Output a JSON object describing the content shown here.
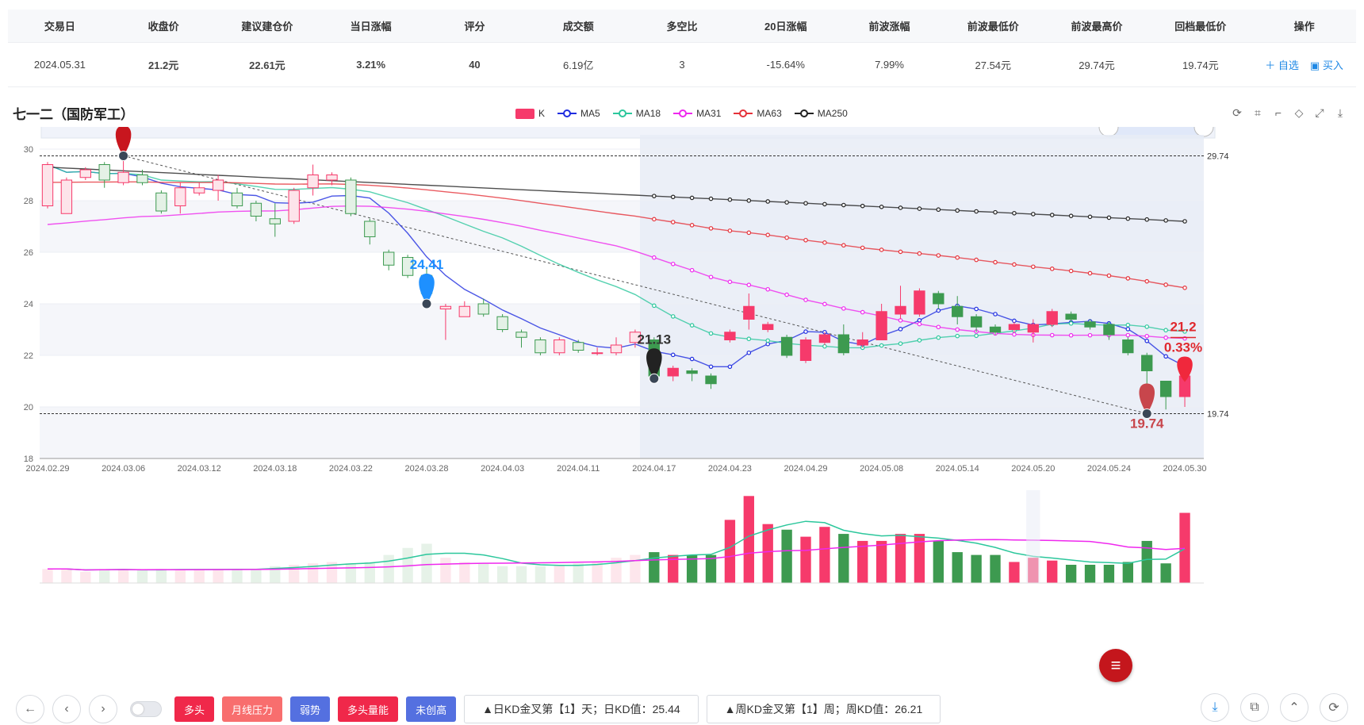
{
  "summary": {
    "headers": [
      "交易日",
      "收盘价",
      "建议建仓价",
      "当日涨幅",
      "评分",
      "成交额",
      "多空比",
      "20日涨幅",
      "前波涨幅",
      "前波最低价",
      "前波最高价",
      "回档最低价",
      "操作"
    ],
    "values": {
      "date": "2024.05.31",
      "close": "21.2元",
      "suggest": "22.61元",
      "day_change": "3.21%",
      "score": "40",
      "amount": "6.19亿",
      "ratio": "3",
      "change20": "-15.64%",
      "wave_change": "7.99%",
      "wave_low": "27.54元",
      "wave_high": "29.74元",
      "pull_low": "19.74元"
    },
    "ops": [
      "＋ 自选",
      "买入"
    ]
  },
  "chart": {
    "stock_name": "七一二（国防军工）",
    "legend": [
      "K",
      "MA5",
      "MA18",
      "MA31",
      "MA63",
      "MA250"
    ],
    "colors": {
      "up": "#f63a6b",
      "down": "#3d9a50",
      "ma5": "#1f2de0",
      "ma18": "#2cc79c",
      "ma31": "#ef28ee",
      "ma63": "#e5323a",
      "ma250": "#222222"
    },
    "y_ticks": [
      "30",
      "28",
      "26",
      "24",
      "22",
      "20",
      "18"
    ],
    "x_ticks": [
      "2024.02.29",
      "2024.03.06",
      "2024.03.12",
      "2024.03.18",
      "2024.03.22",
      "2024.03.28",
      "2024.04.03",
      "2024.04.11",
      "2024.04.17",
      "2024.04.23",
      "2024.04.29",
      "2024.05.08",
      "2024.05.14",
      "2024.05.20",
      "2024.05.24",
      "2024.05.30"
    ],
    "ref_high": "29.74",
    "ref_low": "19.74",
    "marker_high": "29.74",
    "marker_mid1": "24.41",
    "marker_mid2": "21.13",
    "marker_low": "19.74",
    "last_price": "21.2",
    "last_change": "0.33%"
  },
  "chart_data": {
    "type": "candlestick",
    "ylim": [
      18,
      30
    ],
    "dates": [
      "2024.02.29",
      "2024.03.01",
      "2024.03.04",
      "2024.03.05",
      "2024.03.06",
      "2024.03.07",
      "2024.03.08",
      "2024.03.11",
      "2024.03.12",
      "2024.03.13",
      "2024.03.14",
      "2024.03.15",
      "2024.03.18",
      "2024.03.19",
      "2024.03.20",
      "2024.03.21",
      "2024.03.22",
      "2024.03.25",
      "2024.03.26",
      "2024.03.27",
      "2024.03.28",
      "2024.03.29",
      "2024.04.01",
      "2024.04.02",
      "2024.04.03",
      "2024.04.08",
      "2024.04.09",
      "2024.04.10",
      "2024.04.11",
      "2024.04.12",
      "2024.04.15",
      "2024.04.16",
      "2024.04.17",
      "2024.04.18",
      "2024.04.19",
      "2024.04.22",
      "2024.04.23",
      "2024.04.24",
      "2024.04.25",
      "2024.04.26",
      "2024.04.29",
      "2024.04.30",
      "2024.05.06",
      "2024.05.07",
      "2024.05.08",
      "2024.05.09",
      "2024.05.10",
      "2024.05.13",
      "2024.05.14",
      "2024.05.15",
      "2024.05.16",
      "2024.05.17",
      "2024.05.20",
      "2024.05.21",
      "2024.05.22",
      "2024.05.23",
      "2024.05.24",
      "2024.05.27",
      "2024.05.28",
      "2024.05.29",
      "2024.05.30"
    ],
    "ohlc": [
      [
        27.8,
        29.4,
        27.7,
        29.5
      ],
      [
        27.5,
        28.8,
        27.5,
        28.9
      ],
      [
        28.9,
        29.2,
        28.8,
        29.3
      ],
      [
        29.4,
        28.8,
        28.5,
        29.5
      ],
      [
        28.7,
        29.1,
        28.6,
        29.7
      ],
      [
        29.0,
        28.7,
        28.6,
        29.2
      ],
      [
        28.3,
        27.6,
        27.5,
        28.4
      ],
      [
        27.8,
        28.5,
        27.5,
        28.7
      ],
      [
        28.3,
        28.5,
        28.2,
        28.7
      ],
      [
        28.4,
        28.8,
        28.0,
        29.0
      ],
      [
        28.3,
        27.8,
        27.7,
        28.5
      ],
      [
        27.9,
        27.4,
        27.2,
        28.0
      ],
      [
        27.3,
        27.1,
        26.6,
        27.9
      ],
      [
        27.2,
        28.4,
        27.1,
        28.5
      ],
      [
        28.5,
        29.0,
        28.2,
        29.4
      ],
      [
        28.8,
        29.0,
        28.6,
        29.1
      ],
      [
        28.8,
        27.5,
        27.4,
        28.9
      ],
      [
        27.2,
        26.6,
        26.3,
        27.3
      ],
      [
        26.0,
        25.5,
        25.3,
        26.1
      ],
      [
        25.8,
        25.1,
        25.0,
        25.9
      ],
      [
        25.1,
        24.4,
        24.0,
        25.4
      ],
      [
        23.8,
        23.9,
        22.6,
        24.0
      ],
      [
        23.5,
        23.9,
        23.5,
        24.1
      ],
      [
        24.0,
        23.6,
        23.5,
        24.2
      ],
      [
        23.5,
        23.0,
        22.9,
        23.6
      ],
      [
        22.9,
        22.7,
        22.3,
        23.0
      ],
      [
        22.6,
        22.1,
        22.0,
        22.7
      ],
      [
        22.1,
        22.6,
        22.0,
        22.7
      ],
      [
        22.5,
        22.2,
        22.1,
        22.6
      ],
      [
        22.1,
        22.1,
        22.0,
        22.3
      ],
      [
        22.1,
        22.4,
        22.0,
        22.7
      ],
      [
        22.5,
        22.9,
        22.3,
        23.0
      ],
      [
        22.6,
        21.2,
        21.1,
        22.7
      ],
      [
        21.2,
        21.5,
        21.0,
        21.6
      ],
      [
        21.4,
        21.3,
        21.0,
        21.5
      ],
      [
        21.2,
        20.9,
        20.7,
        21.3
      ],
      [
        22.6,
        22.9,
        22.5,
        23.0
      ],
      [
        23.4,
        23.9,
        23.0,
        24.4
      ],
      [
        23.0,
        23.2,
        22.9,
        23.3
      ],
      [
        22.7,
        22.0,
        21.9,
        22.8
      ],
      [
        21.8,
        22.6,
        21.7,
        22.7
      ],
      [
        22.5,
        22.8,
        22.4,
        22.9
      ],
      [
        22.8,
        22.1,
        22.0,
        23.2
      ],
      [
        22.4,
        22.6,
        22.3,
        22.9
      ],
      [
        22.6,
        23.7,
        22.6,
        24.0
      ],
      [
        23.6,
        23.9,
        23.4,
        24.7
      ],
      [
        23.6,
        24.5,
        23.5,
        24.6
      ],
      [
        24.4,
        24.0,
        23.8,
        24.5
      ],
      [
        23.9,
        23.5,
        23.2,
        24.3
      ],
      [
        23.5,
        23.1,
        22.9,
        23.6
      ],
      [
        23.1,
        22.9,
        22.8,
        23.2
      ],
      [
        23.0,
        23.2,
        22.9,
        23.3
      ],
      [
        22.9,
        23.2,
        22.5,
        23.4
      ],
      [
        23.2,
        23.7,
        23.1,
        23.8
      ],
      [
        23.6,
        23.4,
        23.3,
        23.7
      ],
      [
        23.3,
        23.1,
        23.0,
        23.4
      ],
      [
        23.2,
        22.8,
        22.6,
        23.3
      ],
      [
        22.6,
        22.1,
        22.0,
        22.7
      ],
      [
        22.0,
        21.4,
        20.8,
        22.1
      ],
      [
        21.0,
        20.4,
        19.9,
        21.0
      ],
      [
        20.4,
        21.2,
        20.0,
        21.5
      ]
    ],
    "volume_relative": [
      0.1,
      0.1,
      0.08,
      0.1,
      0.1,
      0.09,
      0.1,
      0.09,
      0.1,
      0.1,
      0.1,
      0.1,
      0.12,
      0.13,
      0.14,
      0.15,
      0.14,
      0.15,
      0.2,
      0.25,
      0.28,
      0.18,
      0.15,
      0.14,
      0.12,
      0.12,
      0.12,
      0.13,
      0.14,
      0.15,
      0.18,
      0.2,
      0.22,
      0.2,
      0.2,
      0.2,
      0.45,
      0.62,
      0.42,
      0.38,
      0.33,
      0.4,
      0.35,
      0.3,
      0.3,
      0.35,
      0.35,
      0.3,
      0.22,
      0.2,
      0.2,
      0.15,
      0.18,
      0.16,
      0.13,
      0.13,
      0.13,
      0.15,
      0.3,
      0.14,
      0.5
    ]
  },
  "bottom": {
    "tags": [
      "多头",
      "月线压力",
      "弱势",
      "多头量能",
      "未创高"
    ],
    "tag_colors": [
      "#f0284a",
      "#f86e6e",
      "#5470e0",
      "#f0284a",
      "#5470e0"
    ],
    "kd_day": "▲日KD金叉第【1】天；日KD值：25.44",
    "kd_week": "▲周KD金叉第【1】周；周KD值：26.21"
  }
}
